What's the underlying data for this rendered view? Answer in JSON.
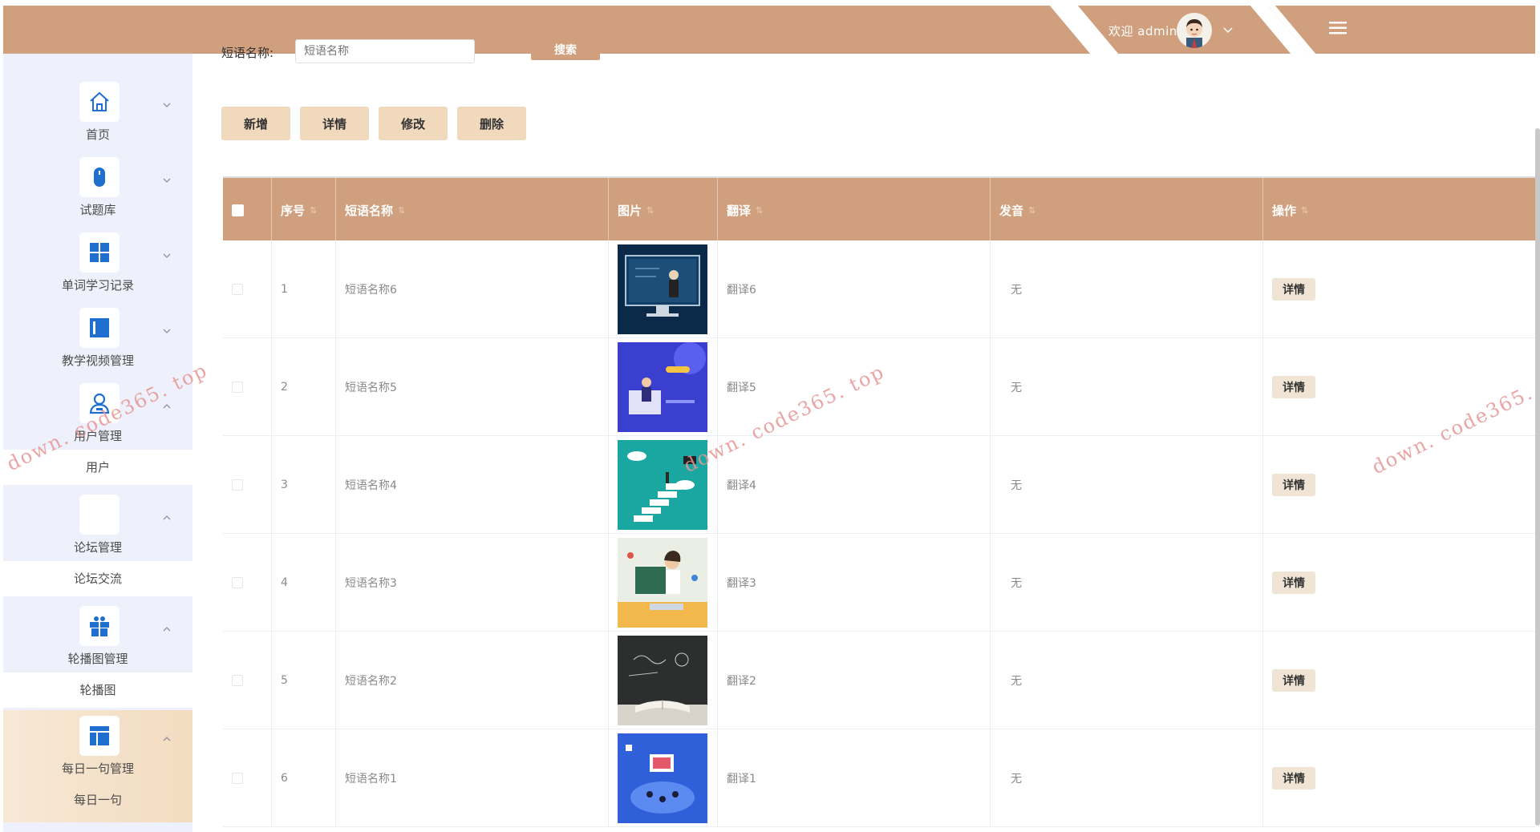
{
  "header": {
    "welcome": "欢迎 admin"
  },
  "sidebar": {
    "groups": [
      {
        "label": "首页",
        "icon": "home-icon"
      },
      {
        "label": "试题库",
        "icon": "mouse-icon"
      },
      {
        "label": "单词学习记录",
        "icon": "grid-icon"
      },
      {
        "label": "教学视频管理",
        "icon": "panel-icon"
      },
      {
        "label": "用户管理",
        "icon": "user-icon",
        "sub": "用户"
      },
      {
        "label": "论坛管理",
        "icon": "blank-icon",
        "sub": "论坛交流"
      },
      {
        "label": "轮播图管理",
        "icon": "gift-icon",
        "sub": "轮播图"
      },
      {
        "label": "每日一句管理",
        "icon": "layout-icon",
        "sub": "每日一句"
      }
    ]
  },
  "search": {
    "label": "短语名称:",
    "placeholder": "短语名称",
    "button": "搜索"
  },
  "actions": {
    "add": "新增",
    "detail": "详情",
    "edit": "修改",
    "delete": "删除"
  },
  "table": {
    "headers": {
      "index": "序号",
      "name": "短语名称",
      "image": "图片",
      "translation": "翻译",
      "audio": "发音",
      "ops": "操作"
    },
    "rows": [
      {
        "index": "1",
        "name": "短语名称6",
        "translation": "翻译6",
        "audio": "无",
        "op": "详情",
        "image": "classroom-monitor"
      },
      {
        "index": "2",
        "name": "短语名称5",
        "translation": "翻译5",
        "audio": "无",
        "op": "详情",
        "image": "study-purple"
      },
      {
        "index": "3",
        "name": "短语名称4",
        "translation": "翻译4",
        "audio": "无",
        "op": "详情",
        "image": "stairs-teal"
      },
      {
        "index": "4",
        "name": "短语名称3",
        "translation": "翻译3",
        "audio": "无",
        "op": "详情",
        "image": "teacher-board"
      },
      {
        "index": "5",
        "name": "短语名称2",
        "translation": "翻译2",
        "audio": "无",
        "op": "详情",
        "image": "book-chalkboard"
      },
      {
        "index": "6",
        "name": "短语名称1",
        "translation": "翻译1",
        "audio": "无",
        "op": "详情",
        "image": "blue-learning"
      }
    ]
  },
  "watermark": "down. code365. top",
  "colors": {
    "accent": "#cf9f7e",
    "button_bg": "#f0d9bd",
    "sidebar_bg": "#eef1fb",
    "watermark": "#e89595"
  }
}
